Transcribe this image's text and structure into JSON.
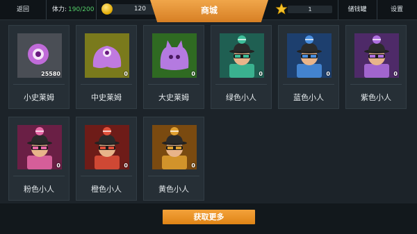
{
  "topbar": {
    "back_label": "返回",
    "stamina_label": "体力:",
    "stamina_value": "190/200",
    "coins": "120",
    "title": "商城",
    "stars": "1",
    "piggy_label": "储钱罐",
    "settings_label": "设置"
  },
  "items": [
    {
      "name": "小史莱姆",
      "count": "25580",
      "kind": "slime-small",
      "bg": "#4a4e55",
      "color": "#c06bd9"
    },
    {
      "name": "中史莱姆",
      "count": "0",
      "kind": "slime-mid",
      "bg": "#7a7a1c",
      "color": "#c07ae0"
    },
    {
      "name": "大史莱姆",
      "count": "0",
      "kind": "slime-big",
      "bg": "#2f6a22",
      "color": "#b47ae0"
    },
    {
      "name": "绿色小人",
      "count": "0",
      "kind": "miner",
      "bg": "#1f5f52",
      "color": "#3fbf9a"
    },
    {
      "name": "蓝色小人",
      "count": "0",
      "kind": "miner",
      "bg": "#1d3f6e",
      "color": "#4a8fe0"
    },
    {
      "name": "紫色小人",
      "count": "0",
      "kind": "miner",
      "bg": "#4e2a68",
      "color": "#b070e0"
    },
    {
      "name": "粉色小人",
      "count": "0",
      "kind": "miner",
      "bg": "#6a1f45",
      "color": "#e86aa8"
    },
    {
      "name": "橙色小人",
      "count": "0",
      "kind": "miner",
      "bg": "#6e1c18",
      "color": "#e0503a"
    },
    {
      "name": "黄色小人",
      "count": "0",
      "kind": "miner",
      "bg": "#7a4a10",
      "color": "#e0a030"
    }
  ],
  "footer": {
    "get_more_label": "获取更多"
  }
}
